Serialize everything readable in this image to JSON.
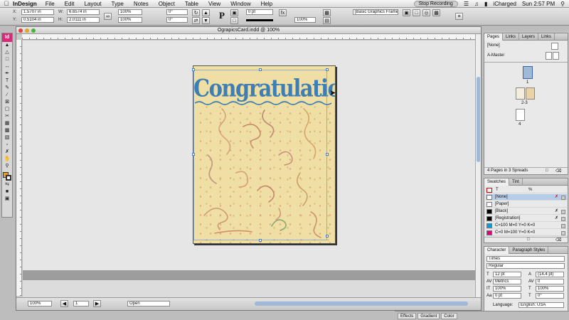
{
  "menubar": {
    "apple": "",
    "app_name": "InDesign",
    "items": [
      "File",
      "Edit",
      "Layout",
      "Type",
      "Notes",
      "Object",
      "Table",
      "View",
      "Window",
      "Help"
    ],
    "recording": "Stop Recording",
    "user": "iCharged",
    "clock": "Sun 2:57 PM"
  },
  "control": {
    "x_label": "X:",
    "x_value": "1.5707 in",
    "y_label": "Y:",
    "y_value": "0.5104 in",
    "w_label": "W:",
    "w_value": "6.6574 in",
    "h_label": "H:",
    "h_value": "2.0111 in",
    "scale_x": "100%",
    "scale_y": "100%",
    "rotate": "0°",
    "shear": "0°",
    "stroke_weight": "0 pt",
    "percent": "100%",
    "style_dropdown": "[Basic Graphics Frame]+",
    "p_icon": "P"
  },
  "document": {
    "title": "OgrapicsCard.indd @ 100%",
    "headline": "Congratulations",
    "zoom": "100%",
    "page_number": "1",
    "status": "Open"
  },
  "pages_panel": {
    "tabs": [
      "Pages",
      "Links",
      "Layers",
      "Links"
    ],
    "none_label": "[None]",
    "master_label": "A-Master",
    "page_labels": [
      "1",
      "2-3",
      "4"
    ],
    "footer": "4 Pages in 3 Spreads"
  },
  "swatches_panel": {
    "tabs": [
      "Swatches",
      "Tint"
    ],
    "tint_value": "%",
    "swatches": [
      {
        "name": "[None]",
        "color": "#ffffff"
      },
      {
        "name": "[Paper]",
        "color": "#ffffff"
      },
      {
        "name": "[Black]",
        "color": "#000000"
      },
      {
        "name": "[Registration]",
        "color": "#000000"
      },
      {
        "name": "C=100 M=0 Y=0 K=0",
        "color": "#00a0e0"
      },
      {
        "name": "C=0 M=100 Y=0 K=0",
        "color": "#e0007a"
      }
    ]
  },
  "character_panel": {
    "tabs": [
      "Character",
      "Paragraph Styles"
    ],
    "font": "Times",
    "style": "Regular",
    "size": "12 pt",
    "leading": "(14.4 pt)",
    "kerning": "Metrics",
    "tracking": "0",
    "vscale": "100%",
    "hscale": "100%",
    "baseline": "0 pt",
    "skew": "0°",
    "language_label": "Language:",
    "language": "English: USA"
  },
  "bottom_tabs": [
    "Effects",
    "Gradient",
    "Color"
  ]
}
